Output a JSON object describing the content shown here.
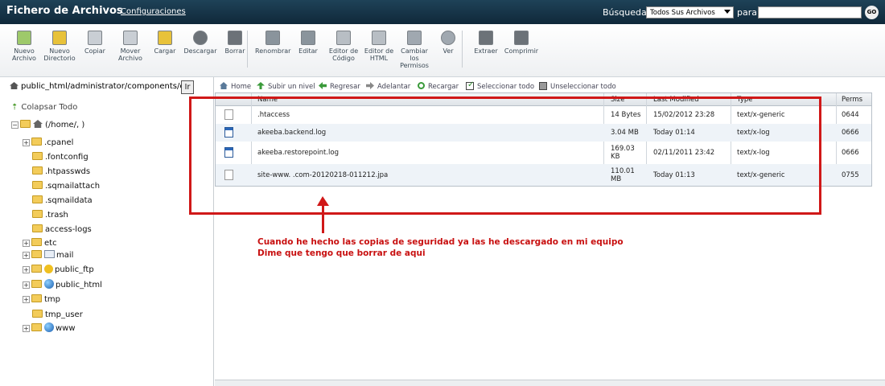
{
  "header": {
    "title": "Fichero de Archivos",
    "config_link": "Configuraciones",
    "search_label": "Búsqueda",
    "search_scope": "Todos Sus Archivos",
    "para_label": "para",
    "search_value": "",
    "go_label": "GO"
  },
  "toolbar": {
    "items": [
      {
        "label": "Nuevo\nArchivo",
        "icon": "new-file-icon"
      },
      {
        "label": "Nuevo\nDirectorio",
        "icon": "new-folder-icon"
      },
      {
        "label": "Copiar",
        "icon": "copy-icon"
      },
      {
        "label": "Mover\nArchivo",
        "icon": "move-icon"
      },
      {
        "label": "Cargar",
        "icon": "upload-icon"
      },
      {
        "label": "Descargar",
        "icon": "download-icon"
      },
      {
        "label": "Borrar",
        "icon": "delete-icon"
      },
      {
        "label": "Renombrar",
        "icon": "rename-icon"
      },
      {
        "label": "Editar",
        "icon": "edit-icon"
      },
      {
        "label": "Editor de\nCódigo",
        "icon": "code-editor-icon"
      },
      {
        "label": "Editor de\nHTML",
        "icon": "html-editor-icon"
      },
      {
        "label": "Cambiar\nlos\nPermisos",
        "icon": "permissions-icon"
      },
      {
        "label": "Ver",
        "icon": "view-icon"
      },
      {
        "label": "Extraer",
        "icon": "extract-icon"
      },
      {
        "label": "Comprimir",
        "icon": "compress-icon"
      }
    ]
  },
  "left": {
    "path": "public_html/administrator/components/cc",
    "ir_label": "Ir",
    "collapse_label": "Colapsar Todo",
    "root_label": "(/home/,            )",
    "tree": [
      {
        "label": ".cpanel",
        "expandable": true
      },
      {
        "label": ".fontconfig",
        "expandable": false
      },
      {
        "label": ".htpasswds",
        "expandable": false
      },
      {
        "label": ".sqmailattach",
        "expandable": false
      },
      {
        "label": ".sqmaildata",
        "expandable": false
      },
      {
        "label": ".trash",
        "expandable": false
      },
      {
        "label": "access-logs",
        "expandable": false
      },
      {
        "label": "etc",
        "expandable": true
      },
      {
        "label": "mail",
        "expandable": true
      },
      {
        "label": "public_ftp",
        "expandable": true
      },
      {
        "label": "public_html",
        "expandable": true
      },
      {
        "label": "tmp",
        "expandable": true
      },
      {
        "label": "tmp_user",
        "expandable": false
      },
      {
        "label": "www",
        "expandable": true
      }
    ]
  },
  "nav": {
    "home": "Home",
    "up": "Subir un nivel",
    "back": "Regresar",
    "forward": "Adelantar",
    "reload": "Recargar",
    "select_all": "Seleccionar todo",
    "unselect_all": "Unseleccionar todo"
  },
  "table": {
    "headers": {
      "name": "Name",
      "size": "Size",
      "modified": "Last Modified",
      "type": "Type",
      "perms": "Perms"
    },
    "rows": [
      {
        "name": ".htaccess",
        "size": "14 Bytes",
        "modified": "15/02/2012 23:28",
        "type": "text/x-generic",
        "perms": "0644",
        "icon": "generic-file-icon"
      },
      {
        "name": "akeeba.backend.log",
        "size": "3.04 MB",
        "modified": "Today 01:14",
        "type": "text/x-log",
        "perms": "0666",
        "icon": "log-file-icon"
      },
      {
        "name": "akeeba.restorepoint.log",
        "size": "169.03\nKB",
        "modified": "02/11/2011 23:42",
        "type": "text/x-log",
        "perms": "0666",
        "icon": "log-file-icon"
      },
      {
        "name": "site-www.            .com-20120218-011212.jpa",
        "size": "110.01\nMB",
        "modified": "Today 01:13",
        "type": "text/x-generic",
        "perms": "0755",
        "icon": "generic-file-icon"
      }
    ]
  },
  "annotation": {
    "line1": "Cuando he hecho las copias de seguridad ya las he descargado en mi equipo",
    "line2": "Dime que tengo que borrar de aqui",
    "color": "#d01818"
  }
}
